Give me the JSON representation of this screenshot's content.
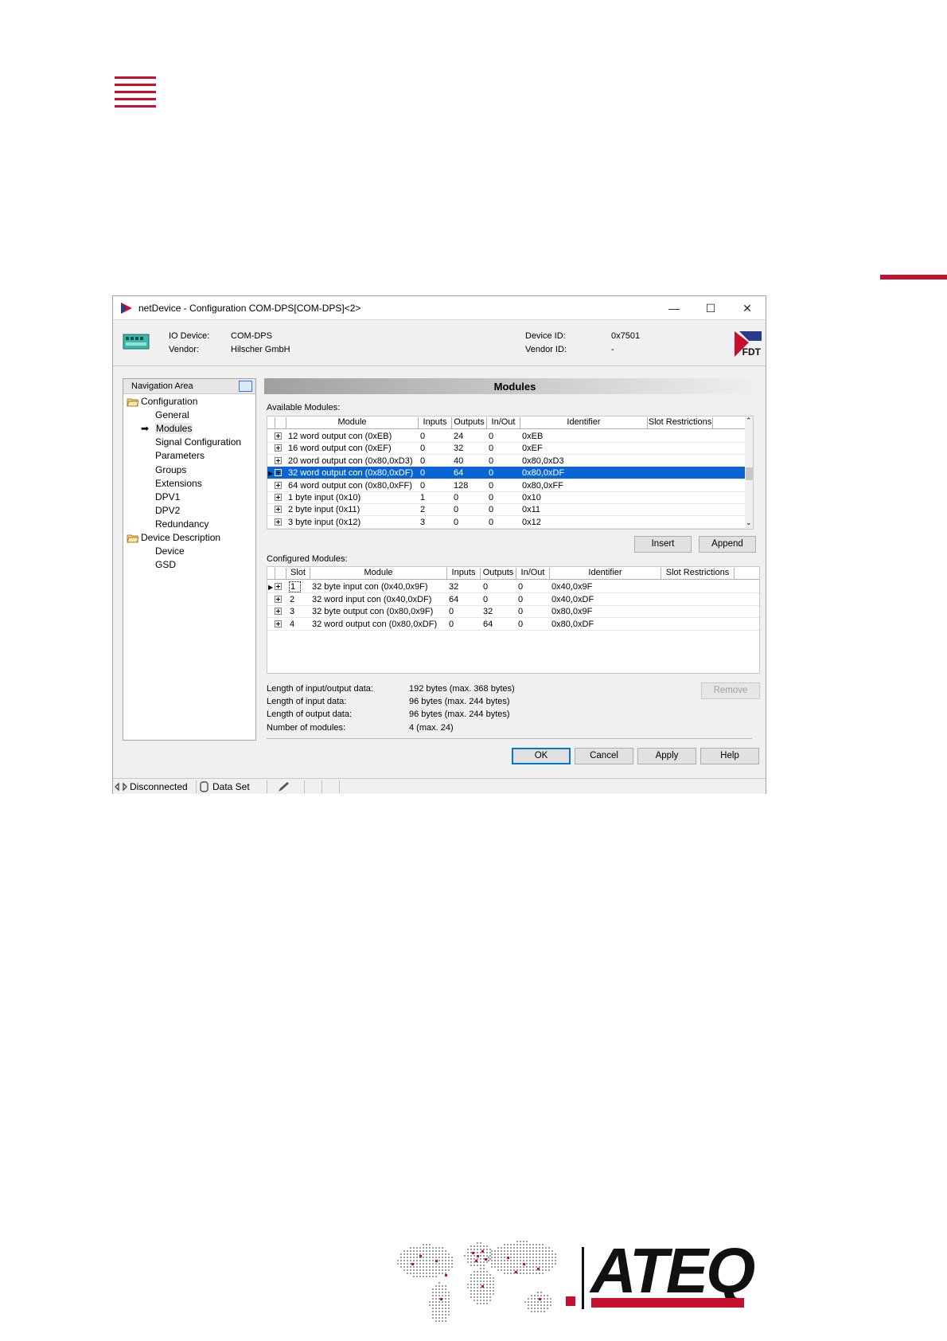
{
  "window": {
    "title": "netDevice - Configuration COM-DPS[COM-DPS]<2>",
    "minimize": "—",
    "maximize": "☐",
    "close": "✕"
  },
  "device_info": {
    "io_device_label": "IO Device:",
    "io_device_value": "COM-DPS",
    "vendor_label": "Vendor:",
    "vendor_value": "Hilscher GmbH",
    "device_id_label": "Device ID:",
    "device_id_value": "0x7501",
    "vendor_id_label": "Vendor ID:",
    "vendor_id_value": "-",
    "logo_text": "FDT"
  },
  "navigation": {
    "header": "Navigation Area",
    "items": [
      {
        "label": "Configuration",
        "level": 0,
        "folder": true
      },
      {
        "label": "General",
        "level": 1
      },
      {
        "label": "Modules",
        "level": 1,
        "selected": true
      },
      {
        "label": "Signal Configuration",
        "level": 1
      },
      {
        "label": "Parameters",
        "level": 1
      },
      {
        "label": "Groups",
        "level": 1
      },
      {
        "label": "Extensions",
        "level": 1
      },
      {
        "label": "DPV1",
        "level": 1
      },
      {
        "label": "DPV2",
        "level": 1
      },
      {
        "label": "Redundancy",
        "level": 1
      },
      {
        "label": "Device Description",
        "level": 0,
        "folder": true
      },
      {
        "label": "Device",
        "level": 1
      },
      {
        "label": "GSD",
        "level": 1
      }
    ]
  },
  "panel_title": "Modules",
  "available": {
    "label": "Available Modules:",
    "columns": [
      "Module",
      "Inputs",
      "Outputs",
      "In/Out",
      "Identifier",
      "Slot Restrictions"
    ],
    "rows": [
      [
        "12 word output con (0xEB)",
        "0",
        "24",
        "0",
        "0xEB",
        ""
      ],
      [
        "16 word output con (0xEF)",
        "0",
        "32",
        "0",
        "0xEF",
        ""
      ],
      [
        "20 word output con (0x80,0xD3)",
        "0",
        "40",
        "0",
        "0x80,0xD3",
        ""
      ],
      [
        "32 word output con (0x80,0xDF)",
        "0",
        "64",
        "0",
        "0x80,0xDF",
        ""
      ],
      [
        "64 word output con (0x80,0xFF)",
        "0",
        "128",
        "0",
        "0x80,0xFF",
        ""
      ],
      [
        "1  byte input   (0x10)",
        "1",
        "0",
        "0",
        "0x10",
        ""
      ],
      [
        "2  byte input   (0x11)",
        "2",
        "0",
        "0",
        "0x11",
        ""
      ],
      [
        "3  byte input   (0x12)",
        "3",
        "0",
        "0",
        "0x12",
        ""
      ]
    ],
    "selected_row": 3
  },
  "buttons": {
    "insert": "Insert",
    "append": "Append",
    "remove": "Remove",
    "ok": "OK",
    "cancel": "Cancel",
    "apply": "Apply",
    "help": "Help"
  },
  "configured": {
    "label": "Configured Modules:",
    "columns": [
      "Slot",
      "Module",
      "Inputs",
      "Outputs",
      "In/Out",
      "Identifier",
      "Slot Restrictions"
    ],
    "rows": [
      [
        "1",
        "32 byte input con  (0x40,0x9F)",
        "32",
        "0",
        "0",
        "0x40,0x9F",
        ""
      ],
      [
        "2",
        "32 word input con  (0x40,0xDF)",
        "64",
        "0",
        "0",
        "0x40,0xDF",
        ""
      ],
      [
        "3",
        "32 byte output con (0x80,0x9F)",
        "0",
        "32",
        "0",
        "0x80,0x9F",
        ""
      ],
      [
        "4",
        "32 word output con (0x80,0xDF)",
        "0",
        "64",
        "0",
        "0x80,0xDF",
        ""
      ]
    ]
  },
  "summary": [
    {
      "label": "Length of input/output data:",
      "value": "192 bytes (max. 368 bytes)"
    },
    {
      "label": "Length of input data:",
      "value": "96 bytes (max. 244 bytes)"
    },
    {
      "label": "Length of output data:",
      "value": "96 bytes (max. 244 bytes)"
    },
    {
      "label": "Number of modules:",
      "value": "4 (max. 24)"
    }
  ],
  "status": {
    "connection": "Disconnected",
    "dataset": "Data Set"
  },
  "brand": {
    "name": "ATEQ",
    "accent_color": "#c8102e",
    "selection_color": "#0a64d6"
  }
}
